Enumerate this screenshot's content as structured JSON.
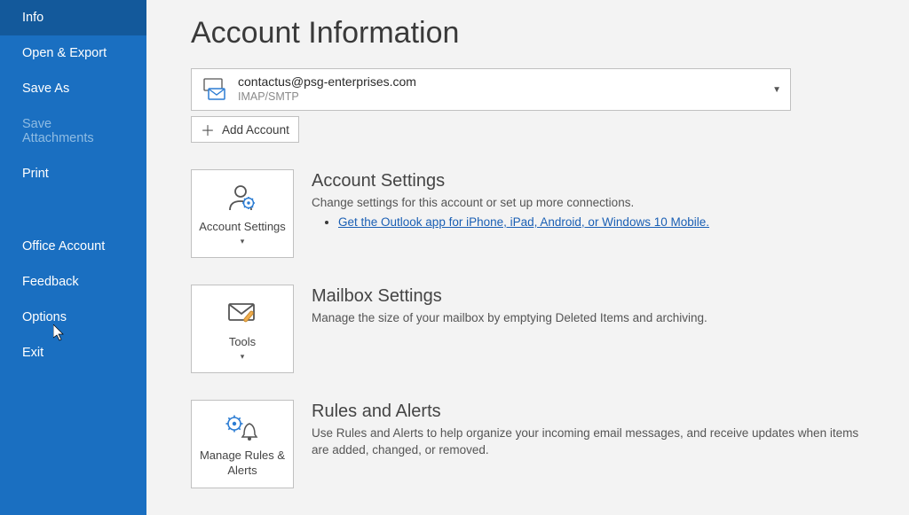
{
  "sidebar": {
    "items": [
      {
        "label": "Info"
      },
      {
        "label": "Open & Export"
      },
      {
        "label": "Save As"
      },
      {
        "label": "Save Attachments"
      },
      {
        "label": "Print"
      },
      {
        "label": "Office Account"
      },
      {
        "label": "Feedback"
      },
      {
        "label": "Options"
      },
      {
        "label": "Exit"
      }
    ]
  },
  "main": {
    "title": "Account Information",
    "account": {
      "email": "contactus@psg-enterprises.com",
      "protocol": "IMAP/SMTP"
    },
    "addAccount": "Add Account",
    "sections": [
      {
        "buttonLabel": "Account Settings",
        "title": "Account Settings",
        "desc": "Change settings for this account or set up more connections.",
        "link": "Get the Outlook app for iPhone, iPad, Android, or Windows 10 Mobile."
      },
      {
        "buttonLabel": "Tools",
        "title": "Mailbox Settings",
        "desc": "Manage the size of your mailbox by emptying Deleted Items and archiving."
      },
      {
        "buttonLabel": "Manage Rules & Alerts",
        "title": "Rules and Alerts",
        "desc": "Use Rules and Alerts to help organize your incoming email messages, and receive updates when items are added, changed, or removed."
      }
    ]
  }
}
